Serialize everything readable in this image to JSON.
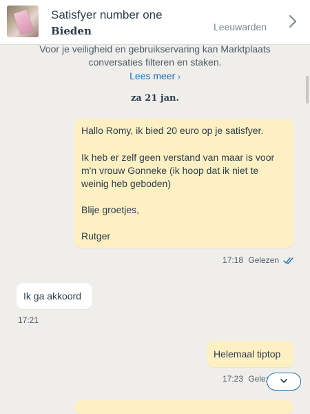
{
  "header": {
    "title": "Satisfyer number one",
    "subtitle": "Bieden",
    "location": "Leeuwarden"
  },
  "notice": {
    "line1": "Voor je veiligheid en gebruikservaring kan Marktplaats",
    "line2": "conversaties filteren en staken.",
    "link": "Lees meer"
  },
  "date_separator": "za 21 jan.",
  "messages": [
    {
      "direction": "outgoing",
      "paragraphs": [
        "Hallo Romy, ik bied 20 euro op je satisfyer.",
        "Ik heb er zelf geen verstand van maar is voor m'n vrouw Gonneke (ik hoop dat ik niet te weinig heb geboden)",
        "Blije groetjes,",
        "Rutger"
      ],
      "time": "17:18",
      "status": "Gelezen"
    },
    {
      "direction": "incoming",
      "text": "Ik ga akkoord",
      "time": "17:21"
    },
    {
      "direction": "outgoing",
      "text": "Helemaal tiptop",
      "time": "17:23",
      "status": "Gelezen"
    }
  ],
  "colors": {
    "background": "#efeeeb",
    "outgoing_bubble": "#fef0c2",
    "incoming_bubble": "#ffffff",
    "link": "#1f6fb2",
    "text": "#2d3c4d"
  },
  "icons": {
    "header_nav": "chevron-right-icon",
    "read_receipt": "double-check-icon",
    "scroll_down": "chevron-down-icon"
  }
}
